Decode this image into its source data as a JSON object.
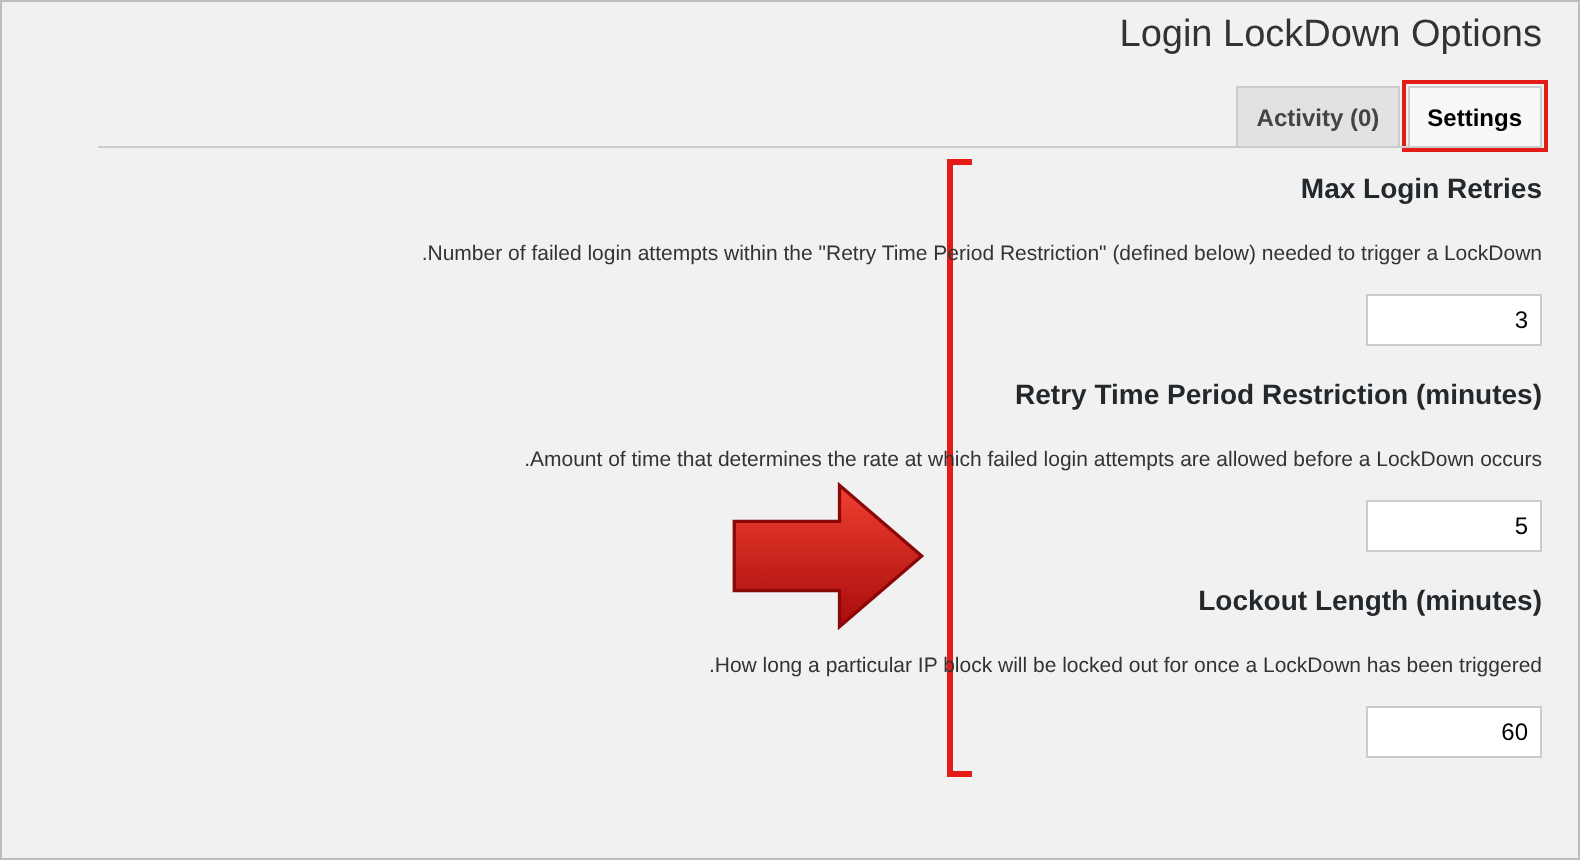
{
  "page_title": "Login LockDown Options",
  "tabs": [
    {
      "label": "Activity (0)",
      "selected": false
    },
    {
      "label": "Settings",
      "selected": true
    }
  ],
  "settings": [
    {
      "heading": "Max Login Retries",
      "description": ".Number of failed login attempts within the \"Retry Time Period Restriction\" (defined below) needed to trigger a LockDown",
      "value": "3"
    },
    {
      "heading": "Retry Time Period Restriction (minutes)",
      "description": ".Amount of time that determines the rate at which failed login attempts are allowed before a LockDown occurs",
      "value": "5"
    },
    {
      "heading": "Lockout Length (minutes)",
      "description": ".How long a particular IP block will be locked out for once a LockDown has been triggered",
      "value": "60"
    }
  ]
}
